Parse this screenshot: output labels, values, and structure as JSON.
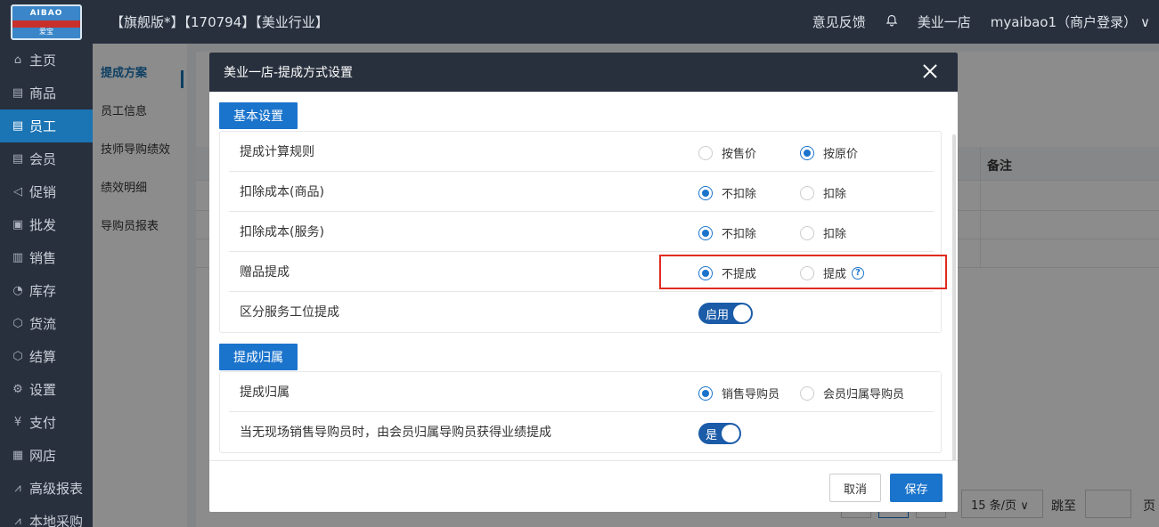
{
  "logo": {
    "top": "AIBAO",
    "bottom": "爱宝"
  },
  "sidebar": {
    "items": [
      {
        "label": "主页",
        "icon": "home-icon",
        "glyph": "⌂"
      },
      {
        "label": "商品",
        "icon": "goods-icon",
        "glyph": "▤"
      },
      {
        "label": "员工",
        "icon": "staff-icon",
        "glyph": "▤",
        "active": true
      },
      {
        "label": "会员",
        "icon": "member-icon",
        "glyph": "▤"
      },
      {
        "label": "促销",
        "icon": "promo-icon",
        "glyph": "◁"
      },
      {
        "label": "批发",
        "icon": "wholesale-icon",
        "glyph": "▣"
      },
      {
        "label": "销售",
        "icon": "sales-icon",
        "glyph": "▥"
      },
      {
        "label": "库存",
        "icon": "inventory-icon",
        "glyph": "◔"
      },
      {
        "label": "货流",
        "icon": "logistics-icon",
        "glyph": "⬡"
      },
      {
        "label": "结算",
        "icon": "settle-icon",
        "glyph": "⬡"
      },
      {
        "label": "设置",
        "icon": "settings-icon",
        "glyph": "⚙"
      },
      {
        "label": "支付",
        "icon": "pay-icon",
        "glyph": "¥"
      },
      {
        "label": "网店",
        "icon": "shop-icon",
        "glyph": "▦"
      },
      {
        "label": "高级报表",
        "icon": "report-icon",
        "glyph": "⩘"
      },
      {
        "label": "本地采购",
        "icon": "purchase-icon",
        "glyph": "⩘"
      }
    ]
  },
  "topbar": {
    "crumb": "【旗舰版*】【170794】【美业行业】",
    "feedback": "意见反馈",
    "store": "美业一店",
    "user": "myaibao1（商户登录）"
  },
  "subnav": {
    "items": [
      {
        "label": "提成方案",
        "active": true
      },
      {
        "label": "员工信息"
      },
      {
        "label": "技师导购绩效"
      },
      {
        "label": "绩效明细"
      },
      {
        "label": "导购员报表"
      }
    ]
  },
  "background": {
    "note_header": "备注",
    "page_size": "15 条/页",
    "goto": "跳至",
    "page_unit": "页"
  },
  "modal": {
    "title": "美业一店-提成方式设置",
    "section1": {
      "tag": "基本设置",
      "rows": [
        {
          "label": "提成计算规则",
          "opt1": "按售价",
          "opt2": "按原价",
          "selected": 2
        },
        {
          "label": "扣除成本(商品)",
          "opt1": "不扣除",
          "opt2": "扣除",
          "selected": 1
        },
        {
          "label": "扣除成本(服务)",
          "opt1": "不扣除",
          "opt2": "扣除",
          "selected": 1
        },
        {
          "label": "赠品提成",
          "opt1": "不提成",
          "opt2": "提成",
          "selected": 1
        },
        {
          "label": "区分服务工位提成",
          "toggle": "启用"
        }
      ]
    },
    "section2": {
      "tag": "提成归属",
      "rows": [
        {
          "label": "提成归属",
          "opt1": "销售导购员",
          "opt2": "会员归属导购员",
          "selected": 1
        },
        {
          "label": "当无现场销售导购员时，由会员归属导购员获得业绩提成",
          "toggle": "是"
        }
      ]
    },
    "cancel": "取消",
    "save": "保存"
  },
  "colors": {
    "primary": "#1b74cc",
    "dark": "#28303e",
    "highlight": "#e02b20"
  }
}
